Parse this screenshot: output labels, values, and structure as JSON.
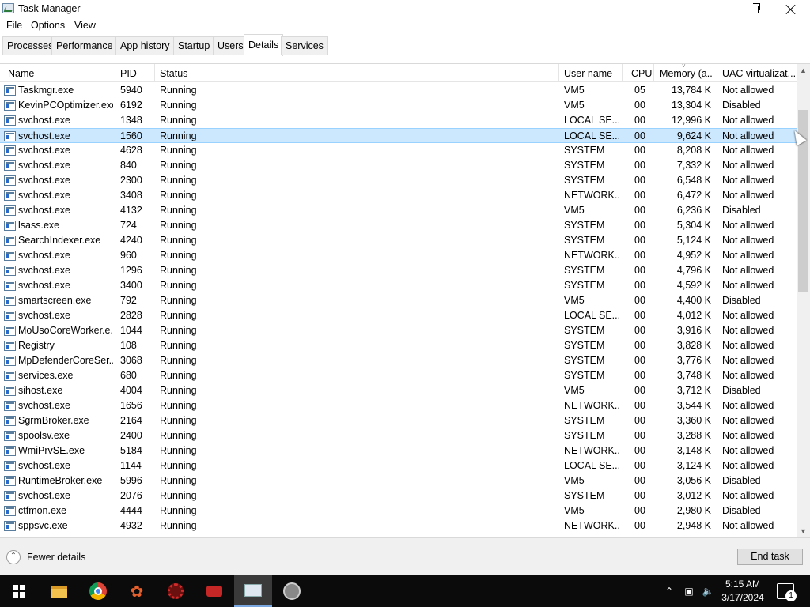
{
  "window": {
    "title": "Task Manager"
  },
  "menu": [
    "File",
    "Options",
    "View"
  ],
  "tabs": [
    {
      "label": "Processes"
    },
    {
      "label": "Performance"
    },
    {
      "label": "App history"
    },
    {
      "label": "Startup"
    },
    {
      "label": "Users"
    },
    {
      "label": "Details",
      "active": true
    },
    {
      "label": "Services"
    }
  ],
  "columns": {
    "name": "Name",
    "pid": "PID",
    "status": "Status",
    "user": "User name",
    "cpu": "CPU",
    "memory": "Memory (a...",
    "uac": "UAC virtualizat..."
  },
  "rows": [
    {
      "name": "Taskmgr.exe",
      "pid": "5940",
      "status": "Running",
      "user": "VM5",
      "cpu": "05",
      "memory": "13,784 K",
      "uac": "Not allowed",
      "icon": "task-manager-icon"
    },
    {
      "name": "KevinPCOptimizer.exe",
      "pid": "6192",
      "status": "Running",
      "user": "VM5",
      "cpu": "00",
      "memory": "13,304 K",
      "uac": "Disabled",
      "icon": "optimizer-icon"
    },
    {
      "name": "svchost.exe",
      "pid": "1348",
      "status": "Running",
      "user": "LOCAL SE...",
      "cpu": "00",
      "memory": "12,996 K",
      "uac": "Not allowed",
      "icon": "window-icon"
    },
    {
      "name": "svchost.exe",
      "pid": "1560",
      "status": "Running",
      "user": "LOCAL SE...",
      "cpu": "00",
      "memory": "9,624 K",
      "uac": "Not allowed",
      "icon": "window-icon",
      "selected": true
    },
    {
      "name": "svchost.exe",
      "pid": "4628",
      "status": "Running",
      "user": "SYSTEM",
      "cpu": "00",
      "memory": "8,208 K",
      "uac": "Not allowed",
      "icon": "window-icon"
    },
    {
      "name": "svchost.exe",
      "pid": "840",
      "status": "Running",
      "user": "SYSTEM",
      "cpu": "00",
      "memory": "7,332 K",
      "uac": "Not allowed",
      "icon": "window-icon"
    },
    {
      "name": "svchost.exe",
      "pid": "2300",
      "status": "Running",
      "user": "SYSTEM",
      "cpu": "00",
      "memory": "6,548 K",
      "uac": "Not allowed",
      "icon": "window-icon"
    },
    {
      "name": "svchost.exe",
      "pid": "3408",
      "status": "Running",
      "user": "NETWORK...",
      "cpu": "00",
      "memory": "6,472 K",
      "uac": "Not allowed",
      "icon": "window-icon"
    },
    {
      "name": "svchost.exe",
      "pid": "4132",
      "status": "Running",
      "user": "VM5",
      "cpu": "00",
      "memory": "6,236 K",
      "uac": "Disabled",
      "icon": "window-icon"
    },
    {
      "name": "lsass.exe",
      "pid": "724",
      "status": "Running",
      "user": "SYSTEM",
      "cpu": "00",
      "memory": "5,304 K",
      "uac": "Not allowed",
      "icon": "window-icon"
    },
    {
      "name": "SearchIndexer.exe",
      "pid": "4240",
      "status": "Running",
      "user": "SYSTEM",
      "cpu": "00",
      "memory": "5,124 K",
      "uac": "Not allowed",
      "icon": "search-indexer-icon"
    },
    {
      "name": "svchost.exe",
      "pid": "960",
      "status": "Running",
      "user": "NETWORK...",
      "cpu": "00",
      "memory": "4,952 K",
      "uac": "Not allowed",
      "icon": "window-icon"
    },
    {
      "name": "svchost.exe",
      "pid": "1296",
      "status": "Running",
      "user": "SYSTEM",
      "cpu": "00",
      "memory": "4,796 K",
      "uac": "Not allowed",
      "icon": "window-icon"
    },
    {
      "name": "svchost.exe",
      "pid": "3400",
      "status": "Running",
      "user": "SYSTEM",
      "cpu": "00",
      "memory": "4,592 K",
      "uac": "Not allowed",
      "icon": "window-icon"
    },
    {
      "name": "smartscreen.exe",
      "pid": "792",
      "status": "Running",
      "user": "VM5",
      "cpu": "00",
      "memory": "4,400 K",
      "uac": "Disabled",
      "icon": "window-icon"
    },
    {
      "name": "svchost.exe",
      "pid": "2828",
      "status": "Running",
      "user": "LOCAL SE...",
      "cpu": "00",
      "memory": "4,012 K",
      "uac": "Not allowed",
      "icon": "window-icon"
    },
    {
      "name": "MoUsoCoreWorker.e...",
      "pid": "1044",
      "status": "Running",
      "user": "SYSTEM",
      "cpu": "00",
      "memory": "3,916 K",
      "uac": "Not allowed",
      "icon": "window-icon"
    },
    {
      "name": "Registry",
      "pid": "108",
      "status": "Running",
      "user": "SYSTEM",
      "cpu": "00",
      "memory": "3,828 K",
      "uac": "Not allowed",
      "icon": "window-icon"
    },
    {
      "name": "MpDefenderCoreSer...",
      "pid": "3068",
      "status": "Running",
      "user": "SYSTEM",
      "cpu": "00",
      "memory": "3,776 K",
      "uac": "Not allowed",
      "icon": "window-icon"
    },
    {
      "name": "services.exe",
      "pid": "680",
      "status": "Running",
      "user": "SYSTEM",
      "cpu": "00",
      "memory": "3,748 K",
      "uac": "Not allowed",
      "icon": "window-icon"
    },
    {
      "name": "sihost.exe",
      "pid": "4004",
      "status": "Running",
      "user": "VM5",
      "cpu": "00",
      "memory": "3,712 K",
      "uac": "Disabled",
      "icon": "window-icon"
    },
    {
      "name": "svchost.exe",
      "pid": "1656",
      "status": "Running",
      "user": "NETWORK...",
      "cpu": "00",
      "memory": "3,544 K",
      "uac": "Not allowed",
      "icon": "window-icon"
    },
    {
      "name": "SgrmBroker.exe",
      "pid": "2164",
      "status": "Running",
      "user": "SYSTEM",
      "cpu": "00",
      "memory": "3,360 K",
      "uac": "Not allowed",
      "icon": "window-icon"
    },
    {
      "name": "spoolsv.exe",
      "pid": "2400",
      "status": "Running",
      "user": "SYSTEM",
      "cpu": "00",
      "memory": "3,288 K",
      "uac": "Not allowed",
      "icon": "printer-icon"
    },
    {
      "name": "WmiPrvSE.exe",
      "pid": "5184",
      "status": "Running",
      "user": "NETWORK...",
      "cpu": "00",
      "memory": "3,148 K",
      "uac": "Not allowed",
      "icon": "window-icon"
    },
    {
      "name": "svchost.exe",
      "pid": "1144",
      "status": "Running",
      "user": "LOCAL SE...",
      "cpu": "00",
      "memory": "3,124 K",
      "uac": "Not allowed",
      "icon": "window-icon"
    },
    {
      "name": "RuntimeBroker.exe",
      "pid": "5996",
      "status": "Running",
      "user": "VM5",
      "cpu": "00",
      "memory": "3,056 K",
      "uac": "Disabled",
      "icon": "window-icon"
    },
    {
      "name": "svchost.exe",
      "pid": "2076",
      "status": "Running",
      "user": "SYSTEM",
      "cpu": "00",
      "memory": "3,012 K",
      "uac": "Not allowed",
      "icon": "window-icon"
    },
    {
      "name": "ctfmon.exe",
      "pid": "4444",
      "status": "Running",
      "user": "VM5",
      "cpu": "00",
      "memory": "2,980 K",
      "uac": "Disabled",
      "icon": "notepad-pen-icon"
    },
    {
      "name": "sppsvc.exe",
      "pid": "4932",
      "status": "Running",
      "user": "NETWORK...",
      "cpu": "00",
      "memory": "2,948 K",
      "uac": "Not allowed",
      "icon": "window-icon"
    }
  ],
  "footer": {
    "fewer_details": "Fewer details",
    "end_task": "End task"
  },
  "taskbar": {
    "clock_time": "5:15 AM",
    "clock_date": "3/17/2024",
    "notification_count": "1"
  },
  "colors": {
    "selected_row": "#cce8ff",
    "selected_border": "#99d1ff",
    "taskbar": "#0b0b0b"
  }
}
